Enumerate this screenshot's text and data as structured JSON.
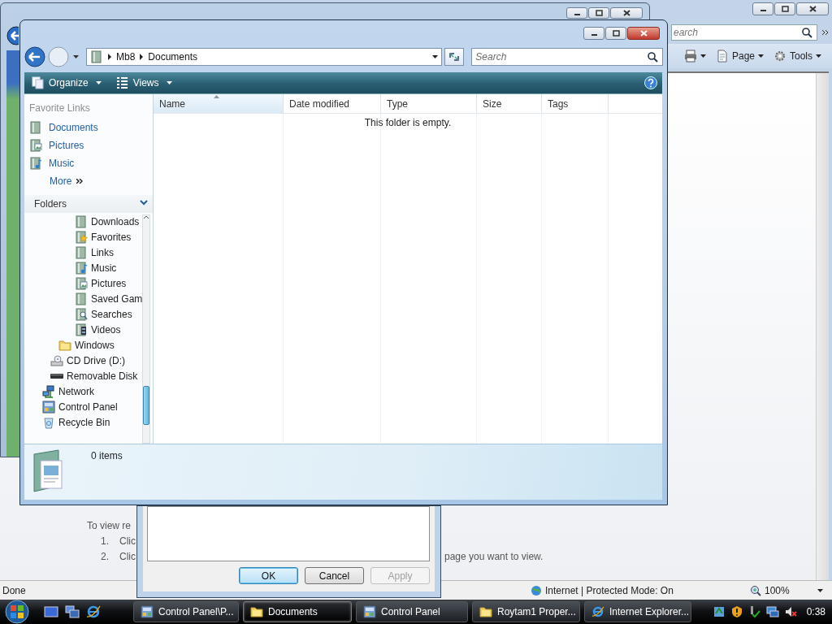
{
  "browser": {
    "search": {
      "placeholder": "earch"
    },
    "commands": [
      {
        "label": "Page",
        "kind": "page"
      },
      {
        "label": "Tools",
        "kind": "tools"
      }
    ],
    "content": {
      "intro": "To view re",
      "steps": [
        {
          "number": "1.",
          "text": "Clic"
        },
        {
          "number": "2.",
          "text": "Clic",
          "tail": "page you want to view."
        }
      ]
    },
    "status_bar": {
      "text": "Done",
      "zone": "Internet | Protected Mode: On",
      "zoom": "100%"
    }
  },
  "dialog": {
    "buttons": [
      {
        "label": "OK",
        "default": true,
        "disabled": false
      },
      {
        "label": "Cancel",
        "default": false,
        "disabled": false
      },
      {
        "label": "Apply",
        "default": false,
        "disabled": true
      }
    ]
  },
  "explorer": {
    "breadcrumb": [
      "Mb8",
      "Documents"
    ],
    "search": {
      "placeholder": "Search"
    },
    "toolbar": [
      {
        "label": "Organize",
        "kind": "organize"
      },
      {
        "label": "Views",
        "kind": "views"
      }
    ],
    "favorite_links": {
      "title": "Favorite Links",
      "items": [
        {
          "label": "Documents",
          "kind": "documents"
        },
        {
          "label": "Pictures",
          "kind": "pictures"
        },
        {
          "label": "Music",
          "kind": "music"
        }
      ],
      "more": "More"
    },
    "folders": {
      "title": "Folders",
      "expanded": true,
      "tree": [
        {
          "children": [
            {
              "children": [
                {
                  "children": [
                    {
                      "children": [
                        {
                          "label": "Downloads",
                          "kind": "library"
                        },
                        {
                          "label": "Favorites",
                          "kind": "favorites"
                        },
                        {
                          "label": "Links",
                          "kind": "library"
                        },
                        {
                          "label": "Music",
                          "kind": "music"
                        },
                        {
                          "label": "Pictures",
                          "kind": "pictures"
                        },
                        {
                          "label": "Saved Gam",
                          "kind": "library"
                        },
                        {
                          "label": "Searches",
                          "kind": "searches"
                        },
                        {
                          "label": "Videos",
                          "kind": "videos"
                        }
                      ]
                    }
                  ]
                },
                {
                  "label": "Windows",
                  "kind": "folder"
                }
              ]
            },
            {
              "label": "CD Drive (D:)",
              "kind": "disc-drive"
            },
            {
              "label": "Removable Disk",
              "kind": "removable"
            }
          ]
        },
        {
          "label": "Network",
          "kind": "network"
        },
        {
          "label": "Control Panel",
          "kind": "control-panel"
        },
        {
          "label": "Recycle Bin",
          "kind": "recycle-bin"
        }
      ]
    },
    "columns": [
      {
        "label": "Name",
        "sorted": true
      },
      {
        "label": "Date modified",
        "sorted": false
      },
      {
        "label": "Type",
        "sorted": false
      },
      {
        "label": "Size",
        "sorted": false
      },
      {
        "label": "Tags",
        "sorted": false
      }
    ],
    "empty_text": "This folder is empty.",
    "details": {
      "count": "0 items"
    }
  },
  "taskbar": {
    "tasks": [
      {
        "label": "Control Panel\\P...",
        "kind": "control-panel",
        "selected": false
      },
      {
        "label": "Documents",
        "kind": "folder",
        "selected": true
      },
      {
        "label": "Control Panel",
        "kind": "control-panel",
        "selected": false
      },
      {
        "label": "Roytam1 Proper...",
        "kind": "folder",
        "selected": false
      },
      {
        "label": "Internet Explorer...",
        "kind": "browser",
        "selected": false
      }
    ],
    "clock": "0:38"
  }
}
